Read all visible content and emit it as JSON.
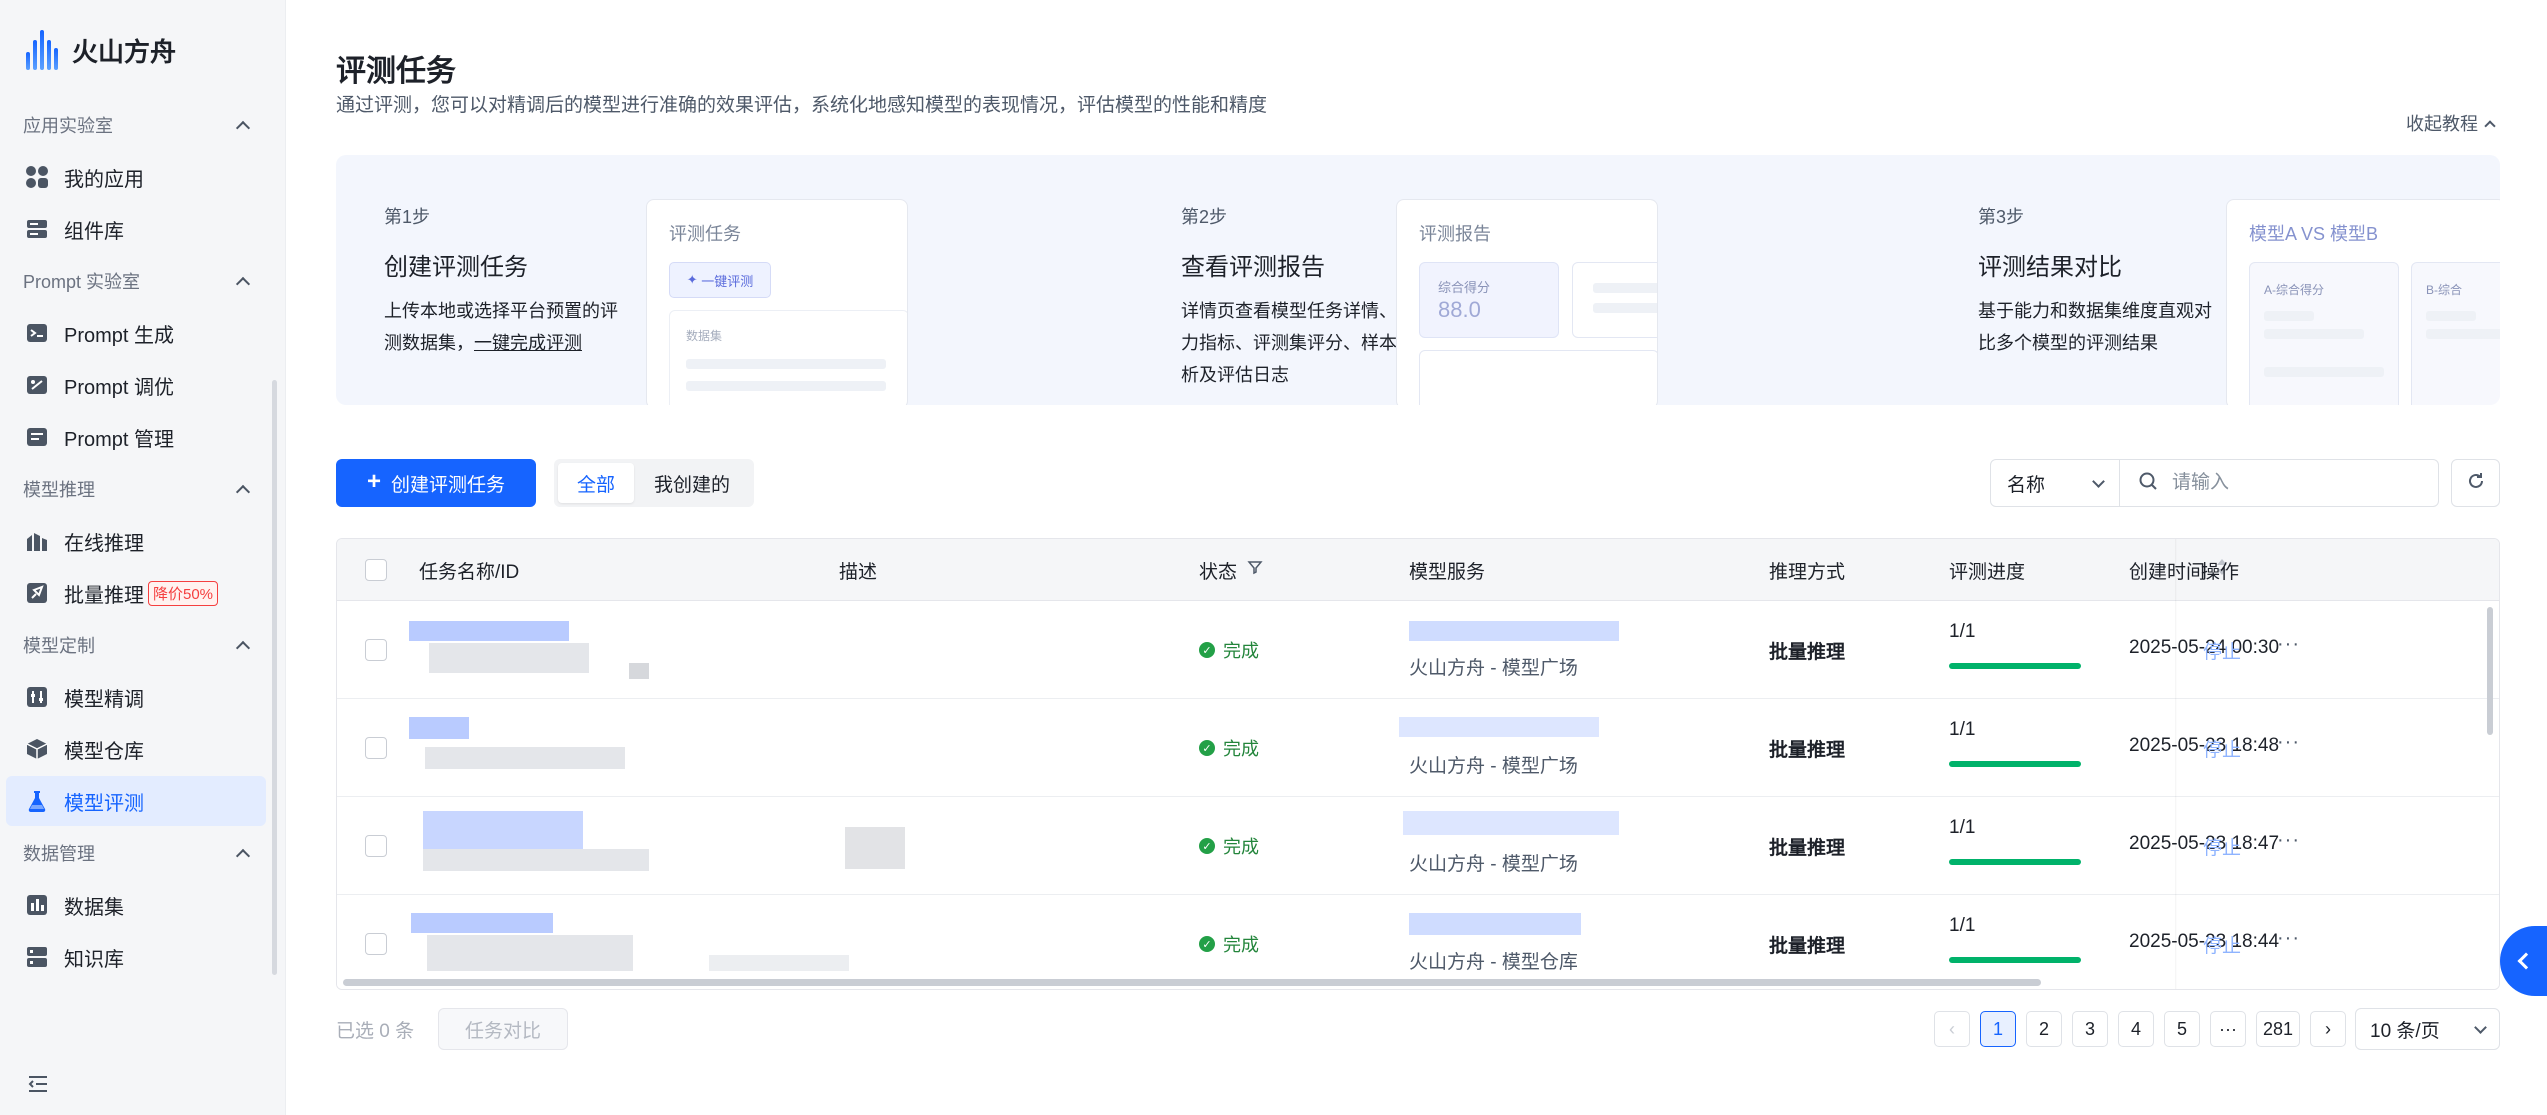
{
  "brand": {
    "name": "火山方舟"
  },
  "sidebar": {
    "groups": [
      {
        "label": "应用实验室",
        "items": [
          {
            "label": "我的应用",
            "icon": "apps-icon"
          },
          {
            "label": "组件库",
            "icon": "component-icon"
          }
        ]
      },
      {
        "label": "Prompt 实验室",
        "items": [
          {
            "label": "Prompt 生成",
            "icon": "prompt-generate-icon"
          },
          {
            "label": "Prompt 调优",
            "icon": "prompt-tune-icon"
          },
          {
            "label": "Prompt 管理",
            "icon": "prompt-manage-icon"
          }
        ]
      },
      {
        "label": "模型推理",
        "items": [
          {
            "label": "在线推理",
            "icon": "online-inference-icon"
          },
          {
            "label": "批量推理",
            "icon": "batch-inference-icon",
            "badge": "降价50%"
          }
        ]
      },
      {
        "label": "模型定制",
        "items": [
          {
            "label": "模型精调",
            "icon": "finetune-icon"
          },
          {
            "label": "模型仓库",
            "icon": "model-repo-icon"
          },
          {
            "label": "模型评测",
            "icon": "eval-flask-icon",
            "active": true
          }
        ]
      },
      {
        "label": "数据管理",
        "items": [
          {
            "label": "数据集",
            "icon": "dataset-icon"
          },
          {
            "label": "知识库",
            "icon": "knowledge-icon"
          }
        ]
      }
    ]
  },
  "page": {
    "title": "评测任务",
    "description": "通过评测，您可以对精调后的模型进行准确的效果评估，系统化地感知模型的表现情况，评估模型的性能和精度",
    "tutorial_toggle": "收起教程"
  },
  "guide": {
    "steps": [
      {
        "no": "第1步",
        "title": "创建评测任务",
        "desc_pre": "上传本地或选择平台预置的评测数据集，",
        "desc_link": "一键完成评测",
        "preview_title": "评测任务",
        "preview_button": "一键评测",
        "preview_field": "数据集"
      },
      {
        "no": "第2步",
        "title": "查看评测报告",
        "desc": "详情页查看模型任务详情、能力指标、评测集评分、样本分析及评估日志",
        "preview_title": "评测报告",
        "score_label": "综合得分",
        "score_value": "88.0"
      },
      {
        "no": "第3步",
        "title": "评测结果对比",
        "desc": "基于能力和数据集维度直观对比多个模型的评测结果",
        "preview_title": "模型A VS 模型B",
        "card_a": "A-综合得分",
        "card_b": "B-综合"
      }
    ]
  },
  "toolbar": {
    "create_label": "创建评测任务",
    "tabs": [
      {
        "label": "全部",
        "active": true
      },
      {
        "label": "我创建的"
      }
    ],
    "filter_field": "名称",
    "search_placeholder": "请输入"
  },
  "table": {
    "columns": [
      "任务名称/ID",
      "描述",
      "状态",
      "模型服务",
      "推理方式",
      "评测进度",
      "创建时间",
      "操作"
    ],
    "rows": [
      {
        "status": "完成",
        "service_source": "火山方舟 - 模型广场",
        "method": "批量推理",
        "progress": "1/1",
        "progress_fraction": 1.0,
        "created": "2025-05-24 00:30",
        "action": "停止"
      },
      {
        "status": "完成",
        "service_source": "火山方舟 - 模型广场",
        "method": "批量推理",
        "progress": "1/1",
        "progress_fraction": 1.0,
        "created": "2025-05-23 18:48",
        "action": "停止"
      },
      {
        "status": "完成",
        "service_source": "火山方舟 - 模型广场",
        "method": "批量推理",
        "progress": "1/1",
        "progress_fraction": 1.0,
        "created": "2025-05-23 18:47",
        "action": "停止"
      },
      {
        "status": "完成",
        "service_source": "火山方舟 - 模型仓库",
        "method": "批量推理",
        "progress": "1/1",
        "progress_fraction": 1.0,
        "created": "2025-05-23 18:44",
        "action": "停止"
      }
    ]
  },
  "footer": {
    "selected": "已选 0 条",
    "compare_label": "任务对比",
    "pages": [
      "1",
      "2",
      "3",
      "4",
      "5",
      "···",
      "281"
    ],
    "current_page": "1",
    "page_size": "10 条/页"
  },
  "colors": {
    "primary": "#1664ff",
    "success": "#23a047",
    "progress": "#00b26a",
    "discount": "#f53f3f"
  }
}
